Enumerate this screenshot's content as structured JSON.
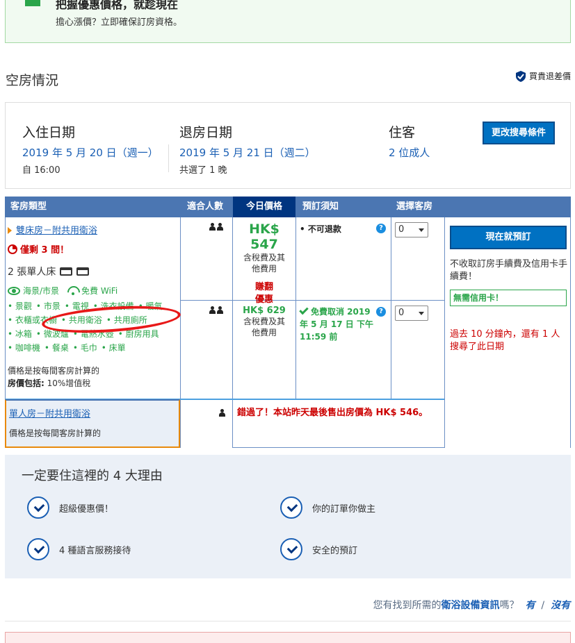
{
  "promo": {
    "title": "把握優惠價格，就趁現在",
    "subtitle": "擔心漲價？立即確保訂房資格。"
  },
  "availability": {
    "title": "空房情況",
    "price_match": "買貴退差價"
  },
  "search": {
    "checkin_label": "入住日期",
    "checkin_date": "2019 年 5 月 20 日（週一）",
    "checkin_time": "自 16:00",
    "checkout_label": "退房日期",
    "checkout_date": "2019 年 5 月 21 日（週二）",
    "nights": "共選了 1 晚",
    "guests_label": "住客",
    "guests_value": "2 位成人",
    "modify_button": "更改搜尋條件"
  },
  "table": {
    "headers": [
      "客房類型",
      "適合人數",
      "今日價格",
      "預訂須知",
      "選擇客房"
    ],
    "room1": {
      "name": "雙床房－附共用衛浴",
      "scarcity": "僅剩 3 間！",
      "beds": "2 張單人床",
      "view": "海景/市景",
      "wifi": "免費 WiFi",
      "amenities": [
        "景觀",
        "市景",
        "電視",
        "洗衣設備",
        "暖氣",
        "衣櫃或衣櫥",
        "共用衛浴",
        "共用廁所",
        "冰箱",
        "微波爐",
        "電熱水壺",
        "廚房用具",
        "咖啡機",
        "餐桌",
        "毛巾",
        "床單"
      ],
      "calc_note": "價格是按每間客房計算的",
      "includes_label": "房價包括:",
      "includes_value": " 10%增值稅",
      "options": [
        {
          "price": "HK$ 547",
          "tax": "含稅費及其他費用",
          "deal": "賺翻優惠",
          "policy": "不可退款",
          "qty": "0"
        },
        {
          "price": "HK$ 629",
          "tax": "含稅費及其他費用",
          "policy": "免費取消 2019 年 5 月 17 日 下午11:59 前",
          "qty": "0"
        }
      ]
    },
    "book_button": "現在就預訂",
    "no_fee": "不收取訂房手續費及信用卡手續費！",
    "no_cc": "無需信用卡！",
    "recent": "過去 10 分鐘內，還有 1 人搜尋了此日期",
    "room2": {
      "name": "單人房－附共用衛浴",
      "calc_note": "價格是按每間客房計算的",
      "missed": "錯過了！本站昨天最後售出房價為 HK$ 546。"
    }
  },
  "reasons": {
    "title": "一定要住這裡的 4 大理由",
    "items": [
      "超級優惠價！",
      "你的訂單你做主",
      "4 種語言服務接待",
      "安全的預訂"
    ]
  },
  "feedback": {
    "question_prefix": "您有找到所需的",
    "question_topic": "衛浴設備資訊",
    "question_suffix": "嗎？",
    "yes": "有",
    "sep": "/",
    "no": "沒有"
  }
}
